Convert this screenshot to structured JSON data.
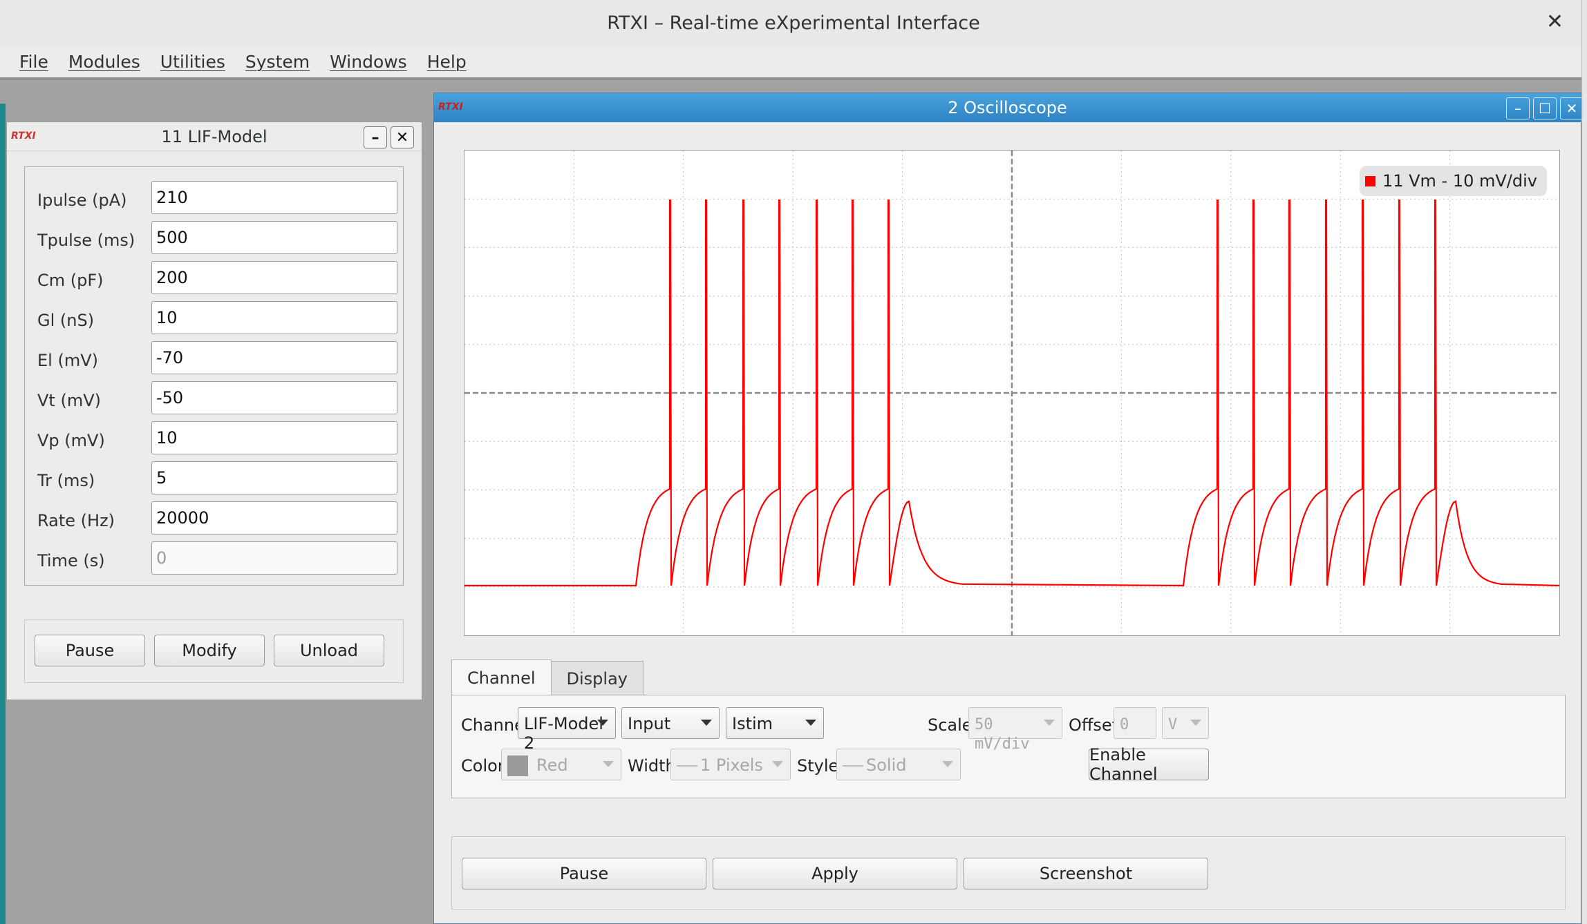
{
  "window": {
    "title": "RTXI – Real-time eXperimental Interface",
    "close_glyph": "✕"
  },
  "menu": [
    "File",
    "Modules",
    "Utilities",
    "System",
    "Windows",
    "Help"
  ],
  "lif": {
    "logo": "RTXI",
    "title": "11 LIF-Model",
    "minimize_glyph": "–",
    "close_glyph": "✕",
    "params": [
      {
        "label": "Ipulse (pA)",
        "value": "210"
      },
      {
        "label": "Tpulse (ms)",
        "value": "500"
      },
      {
        "label": "Cm (pF)",
        "value": "200"
      },
      {
        "label": "Gl (nS)",
        "value": "10"
      },
      {
        "label": "El (mV)",
        "value": "-70"
      },
      {
        "label": "Vt (mV)",
        "value": "-50"
      },
      {
        "label": "Vp (mV)",
        "value": "10"
      },
      {
        "label": "Tr (ms)",
        "value": "5"
      },
      {
        "label": "Rate (Hz)",
        "value": "20000"
      },
      {
        "label": "Time (s)",
        "value": "0"
      }
    ],
    "buttons": {
      "pause": "Pause",
      "modify": "Modify",
      "unload": "Unload"
    }
  },
  "osc": {
    "logo": "RTXI",
    "title": "2 Oscilloscope",
    "win_glyphs": {
      "minimize": "–",
      "maximize": "☐",
      "close": "✕"
    },
    "legend": "11 Vm - 10 mV/div",
    "trace_color": "#ff0000",
    "tabs": [
      "Channel",
      "Display"
    ],
    "channel": {
      "channel_label": "Channel:",
      "channel_value": "LIF-Model 2",
      "type_value": "Input",
      "signal_value": "Istim",
      "scale_label": "Scale:",
      "scale_value": "50 mV/div",
      "offset_label": "Offset:",
      "offset_value": "0",
      "offset_unit": "V",
      "color_label": "Color:",
      "color_value": "Red",
      "width_label": "Width:",
      "width_value": "1 Pixels",
      "style_label": "Style:",
      "style_value": "Solid",
      "enable_button": "Enable Channel"
    },
    "buttons": {
      "pause": "Pause",
      "apply": "Apply",
      "screenshot": "Screenshot"
    }
  }
}
